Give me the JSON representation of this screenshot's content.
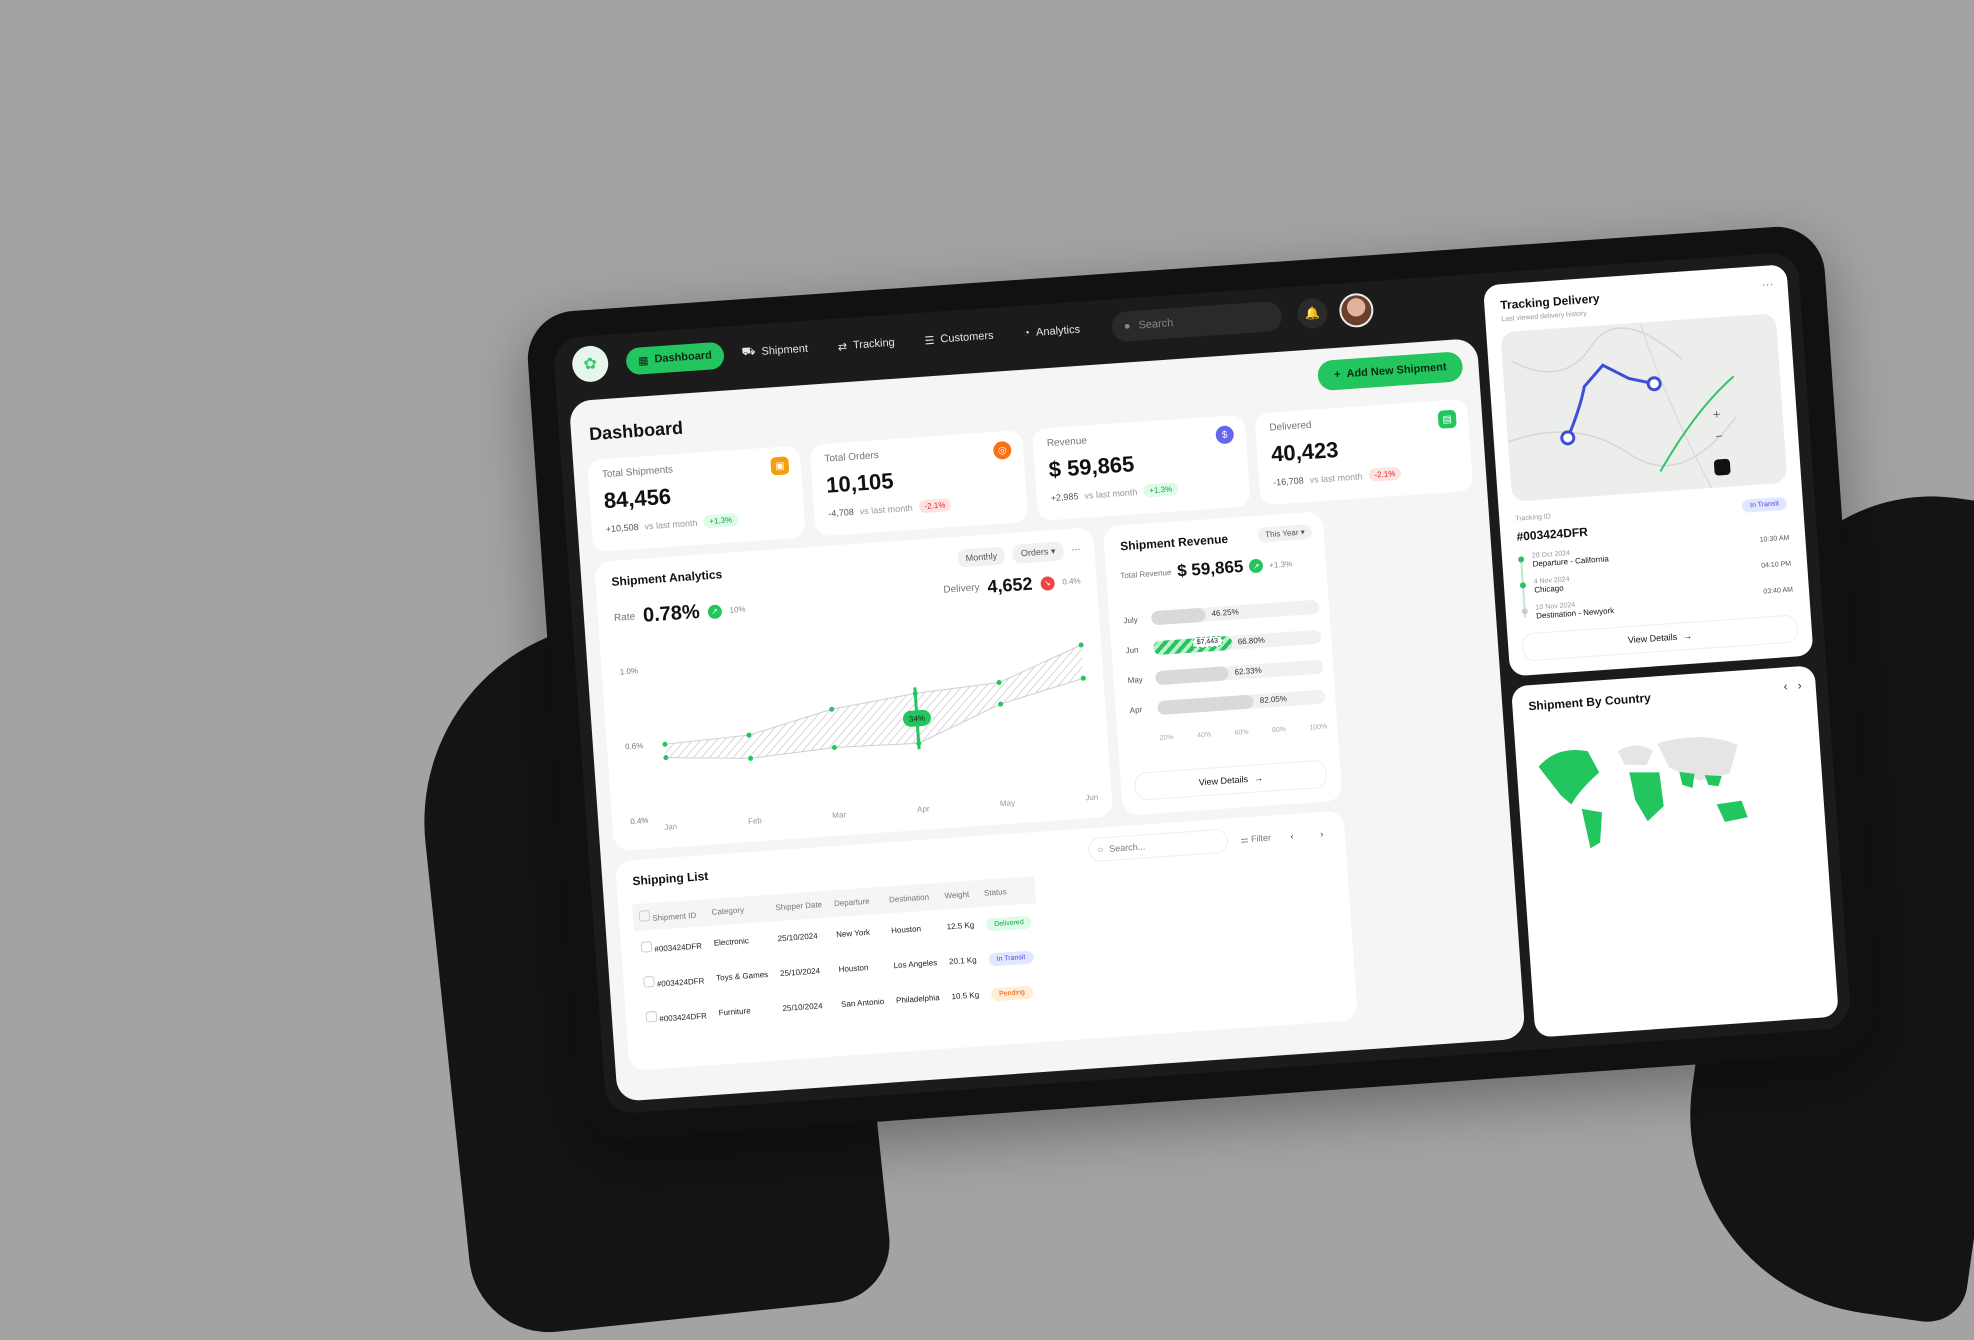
{
  "nav": {
    "items": [
      {
        "label": "Dashboard",
        "icon": "grid-icon",
        "active": true
      },
      {
        "label": "Shipment",
        "icon": "truck-icon",
        "active": false
      },
      {
        "label": "Tracking",
        "icon": "route-icon",
        "active": false
      },
      {
        "label": "Customers",
        "icon": "users-icon",
        "active": false
      },
      {
        "label": "Analytics",
        "icon": "pie-chart-icon",
        "active": false
      }
    ],
    "search_placeholder": "Search"
  },
  "page": {
    "title": "Dashboard",
    "add_button": "Add New Shipment"
  },
  "stats": [
    {
      "label": "Total Shipments",
      "value": "84,456",
      "delta": "+10,508",
      "compare": "vs last month",
      "chip": "+1.3%",
      "trend": "up",
      "badge_color": "#f59e0b"
    },
    {
      "label": "Total Orders",
      "value": "10,105",
      "delta": "-4,708",
      "compare": "vs last month",
      "chip": "-2.1%",
      "trend": "down",
      "badge_color": "#f97316"
    },
    {
      "label": "Revenue",
      "value": "$ 59,865",
      "delta": "+2,985",
      "compare": "vs last month",
      "chip": "+1.3%",
      "trend": "up",
      "badge_color": "#6366f1"
    },
    {
      "label": "Delivered",
      "value": "40,423",
      "delta": "-16,708",
      "compare": "vs last month",
      "chip": "-2.1%",
      "trend": "down",
      "badge_color": "#22c55e"
    }
  ],
  "analytics": {
    "title": "Shipment Analytics",
    "period": "Monthly",
    "metric": "Orders",
    "rate_label": "Rate",
    "rate_value": "0.78%",
    "rate_chip": "10%",
    "delivery_label": "Delivery",
    "delivery_value": "4,652",
    "delivery_chip": "0.4%"
  },
  "chart_data": {
    "type": "area",
    "categories": [
      "Jan",
      "Feb",
      "Mar",
      "Apr",
      "May",
      "Jun"
    ],
    "series": [
      {
        "values": [
          0.78,
          0.8,
          0.92,
          0.98,
          1.01,
          1.2
        ]
      },
      {
        "values": [
          0.7,
          0.66,
          0.69,
          0.68,
          0.88,
          1.0
        ]
      }
    ],
    "highlight": {
      "category": "Apr",
      "label": "34%"
    },
    "yticks": [
      "1.0%",
      "0.6%",
      "0.4%"
    ],
    "ylim": [
      0.4,
      1.3
    ],
    "grid": false
  },
  "revenue": {
    "title": "Shipment Revenue",
    "range": "This Year",
    "total_label": "Total Revenue",
    "total_value": "$ 59,865",
    "total_chip": "+1.3%",
    "bars": [
      {
        "month": "July",
        "pct": 0.4625,
        "label": "46.25%",
        "highlight": false
      },
      {
        "month": "Jun",
        "pct": 0.668,
        "label": "66.80%",
        "highlight": true,
        "flag": "$7,443"
      },
      {
        "month": "May",
        "pct": 0.6233,
        "label": "62.33%",
        "highlight": false
      },
      {
        "month": "Apr",
        "pct": 0.8205,
        "label": "82.05%",
        "highlight": false
      }
    ],
    "axis": [
      "20%",
      "40%",
      "60%",
      "80%",
      "100%"
    ],
    "view_details": "View Details"
  },
  "shipping": {
    "title": "Shipping List",
    "search_placeholder": "Search...",
    "filter_label": "Filter",
    "columns": [
      "Shipment ID",
      "Category",
      "Shipper Date",
      "Departure",
      "Destination",
      "Weight",
      "Status"
    ],
    "rows": [
      {
        "id": "#003424DFR",
        "category": "Electronic",
        "date": "25/10/2024",
        "departure": "New York",
        "destination": "Houston",
        "weight": "12.5 Kg",
        "status": "Delivered",
        "status_type": "delivered"
      },
      {
        "id": "#003424DFR",
        "category": "Toys & Games",
        "date": "25/10/2024",
        "departure": "Houston",
        "destination": "Los Angeles",
        "weight": "20.1 Kg",
        "status": "In Transit",
        "status_type": "transit"
      },
      {
        "id": "#003424DFR",
        "category": "Furniture",
        "date": "25/10/2024",
        "departure": "San Antonio",
        "destination": "Philadelphia",
        "weight": "10.5 Kg",
        "status": "Pending",
        "status_type": "pending"
      }
    ]
  },
  "tracking": {
    "title": "Tracking Delivery",
    "subtitle": "Last viewed delivery history",
    "id_label": "Tracking ID",
    "id": "#003424DFR",
    "status": "In Transit",
    "steps": [
      {
        "date": "28 Oct 2024",
        "place": "Departure - California",
        "time": "10:30 AM",
        "done": true
      },
      {
        "date": "4 Nov 2024",
        "place": "Chicago",
        "time": "04:10 PM",
        "done": true
      },
      {
        "date": "10 Nov 2024",
        "place": "Destination - Newyork",
        "time": "03:40 AM",
        "done": false
      }
    ],
    "view_details": "View Details"
  },
  "country": {
    "title": "Shipment By Country"
  }
}
